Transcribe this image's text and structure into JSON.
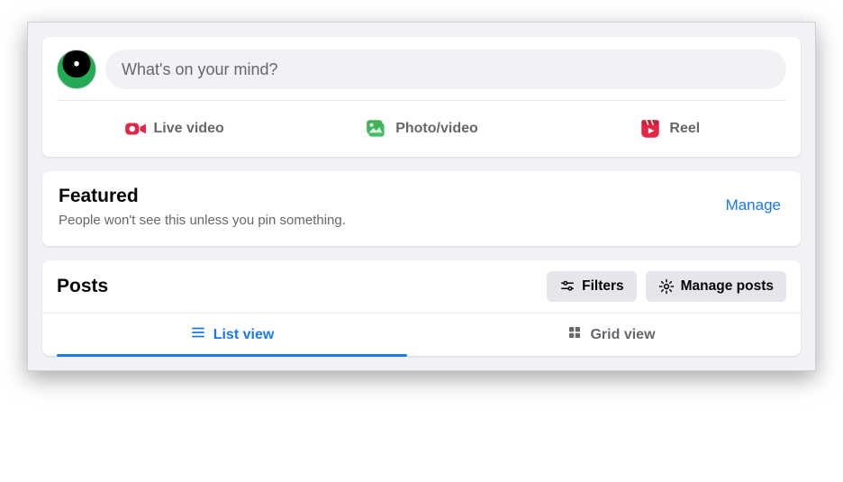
{
  "composer": {
    "placeholder": "What's on your mind?",
    "actions": {
      "live": "Live video",
      "photo": "Photo/video",
      "reel": "Reel"
    }
  },
  "featured": {
    "title": "Featured",
    "subtitle": "People won't see this unless you pin something.",
    "manage": "Manage"
  },
  "posts": {
    "title": "Posts",
    "filters": "Filters",
    "manage": "Manage posts",
    "list_view": "List view",
    "grid_view": "Grid view"
  }
}
